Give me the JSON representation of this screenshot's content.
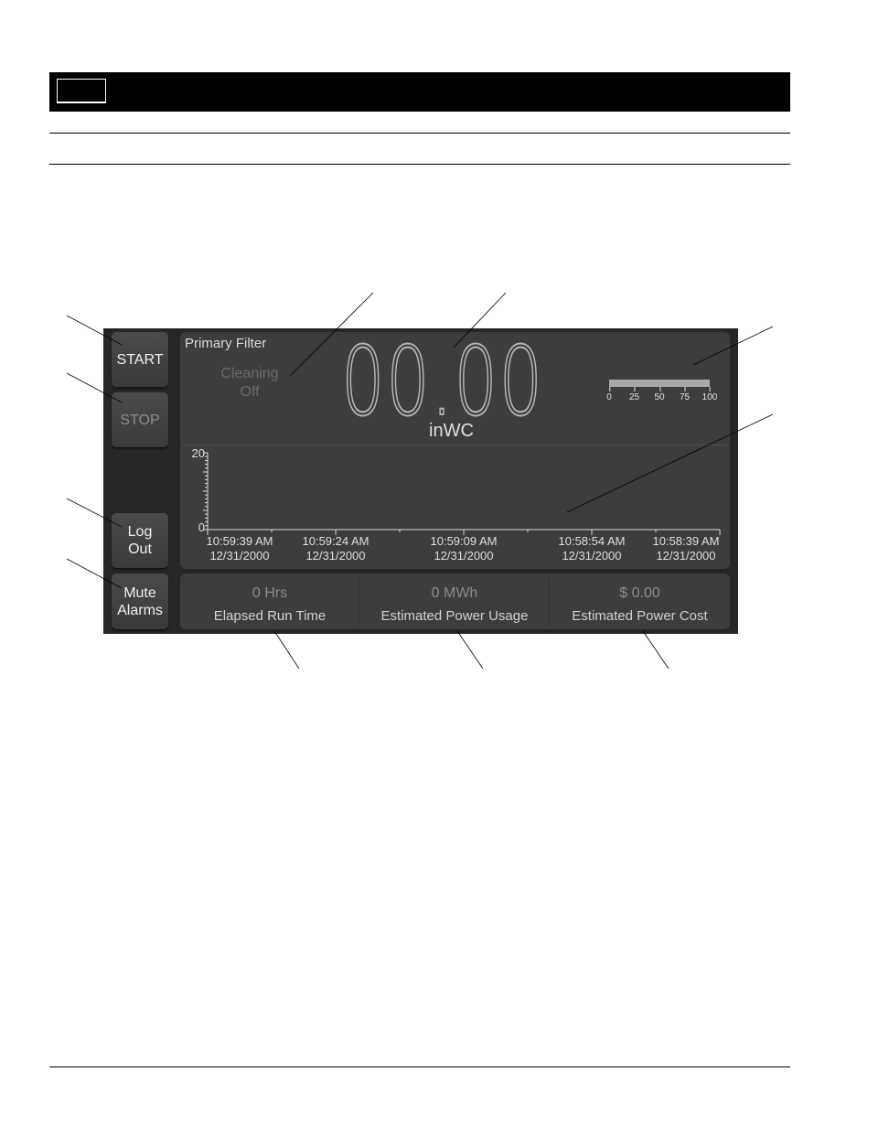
{
  "document": {
    "header_box_label": ""
  },
  "screen": {
    "buttons": [
      {
        "label": "START",
        "enabled": true
      },
      {
        "label": "STOP",
        "enabled": false
      },
      {
        "label": "Log\nOut",
        "enabled": true
      },
      {
        "label": "Mute\nAlarms",
        "enabled": true
      }
    ],
    "panel_title": "Primary Filter",
    "cleaning_status": {
      "line1": "Cleaning",
      "line2": "Off"
    },
    "pressure_value": "00.00",
    "pressure_unit": "inWC",
    "gauge": {
      "tick_labels": [
        "0",
        "25",
        "50",
        "75",
        "100"
      ],
      "value_fraction": 1.0,
      "color": "#a8a8a8"
    },
    "stats": [
      {
        "value": "0 Hrs",
        "label": "Elapsed Run Time"
      },
      {
        "value": "0 MWh",
        "label": "Estimated Power Usage"
      },
      {
        "value": "$ 0.00",
        "label": "Estimated Power Cost"
      }
    ]
  },
  "chart_data": {
    "type": "line",
    "title": "",
    "xlabel": "",
    "ylabel": "",
    "ylim": [
      0,
      20
    ],
    "y_tick_labels": [
      "20",
      "0"
    ],
    "x_tick_labels": [
      {
        "time": "10:59:39 AM",
        "date": "12/31/2000"
      },
      {
        "time": "10:59:24 AM",
        "date": "12/31/2000"
      },
      {
        "time": "10:59:09 AM",
        "date": "12/31/2000"
      },
      {
        "time": "10:58:54 AM",
        "date": "12/31/2000"
      },
      {
        "time": "10:58:39 AM",
        "date": "12/31/2000"
      }
    ],
    "series": [],
    "grid": false
  }
}
